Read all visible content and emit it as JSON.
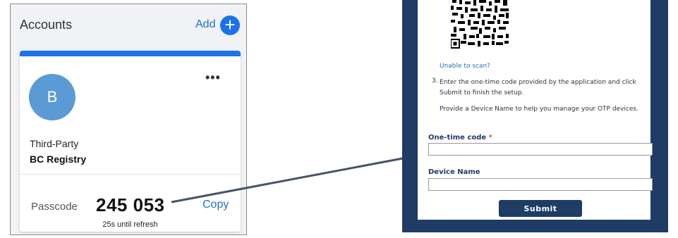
{
  "authenticator": {
    "title": "Accounts",
    "add_label": "Add",
    "add_icon": "plus-icon",
    "card": {
      "avatar_letter": "B",
      "more_icon": "ellipsis-icon",
      "issuer": "Third-Party",
      "account_name": "BC Registry",
      "passcode_label": "Passcode",
      "passcode": "245 053",
      "copy_label": "Copy",
      "refresh_text": "25s until refresh"
    },
    "colors": {
      "accent": "#1a73e8",
      "avatar": "#5b9bd5"
    }
  },
  "otp_form": {
    "unable_to_scan": "Unable to scan?",
    "step_number": "3.",
    "step_text": "Enter the one-time code provided by the application and click Submit to finish the setup.",
    "device_help": "Provide a Device Name to help you manage your OTP devices.",
    "code_label": "One-time code",
    "required_marker": "*",
    "code_value": "",
    "device_label": "Device Name",
    "device_value": "",
    "submit_label": "Submit",
    "colors": {
      "frame": "#1f3c64",
      "link": "#2a6ebb"
    }
  }
}
